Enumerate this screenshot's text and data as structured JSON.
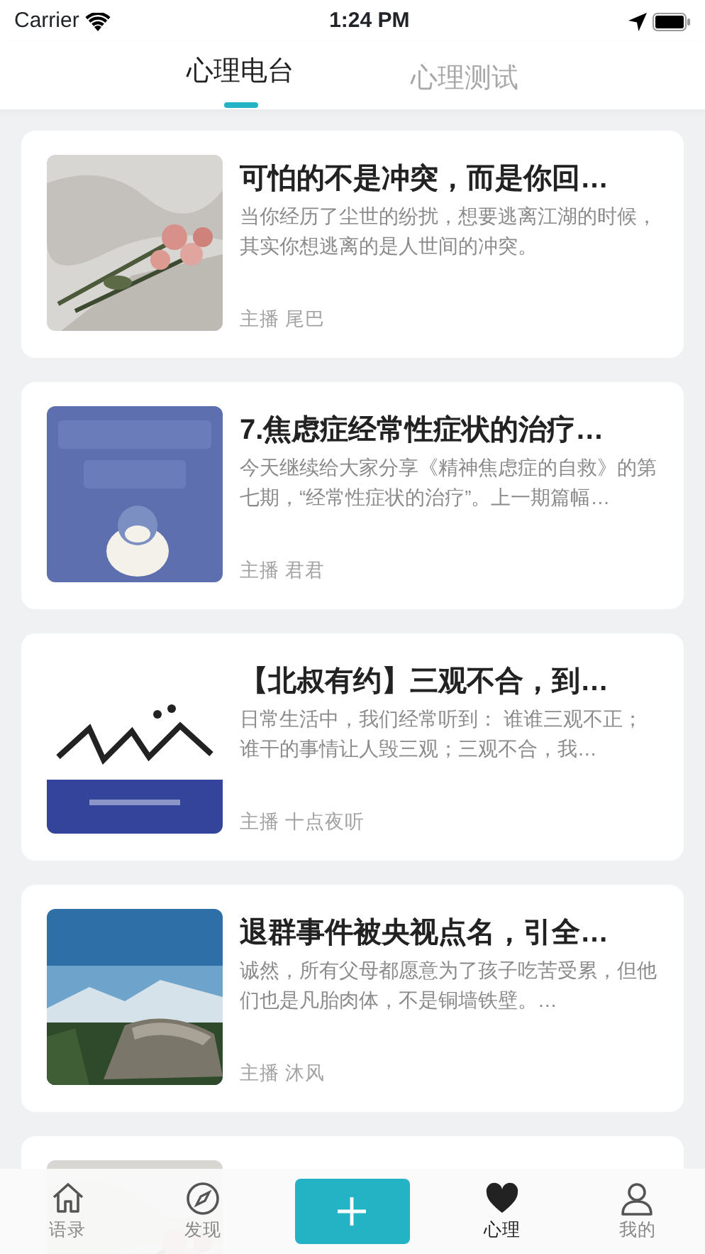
{
  "status_bar": {
    "carrier": "Carrier",
    "time": "1:24 PM"
  },
  "tabs": [
    {
      "label": "心理电台",
      "selected": true
    },
    {
      "label": "心理测试",
      "selected": false
    }
  ],
  "articles": [
    {
      "title": "可怕的不是冲突，而是你回…",
      "description": "当你经历了尘世的纷扰，想要逃离江湖的时候，其实你想逃离的是人世间的冲突。",
      "host_label": "主播",
      "host": "尾巴",
      "thumbnail": {
        "kind": "picture"
      }
    },
    {
      "title": "7.焦虑症经常性症状的治疗…",
      "description": "今天继续给大家分享《精神焦虑症的自救》的第七期，“经常性症状的治疗”。上一期篇幅…",
      "host_label": "主播",
      "host": "君君",
      "thumbnail": {
        "kind": "picture"
      }
    },
    {
      "title": "【北叔有约】三观不合，到…",
      "description": "日常生活中，我们经常听到： 谁谁三观不正；谁干的事情让人毁三观；三观不合，我…",
      "host_label": "主播",
      "host": "十点夜听",
      "thumbnail": {
        "kind": "picture"
      }
    },
    {
      "title": "退群事件被央视点名，引全…",
      "description": "诚然，所有父母都愿意为了孩子吃苦受累，但他们也是凡胎肉体，不是铜墙铁壁。…",
      "host_label": "主播",
      "host": "沐风",
      "thumbnail": {
        "kind": "picture"
      }
    },
    {
      "thumbnail": {
        "kind": "picture"
      }
    }
  ],
  "tab_bar": [
    {
      "kind": "home",
      "label": "语录",
      "selected": false
    },
    {
      "kind": "compass",
      "label": "发现",
      "selected": false
    },
    {
      "kind": "add"
    },
    {
      "kind": "heart",
      "label": "心理",
      "selected": true
    },
    {
      "kind": "person",
      "label": "我的",
      "selected": false
    }
  ]
}
